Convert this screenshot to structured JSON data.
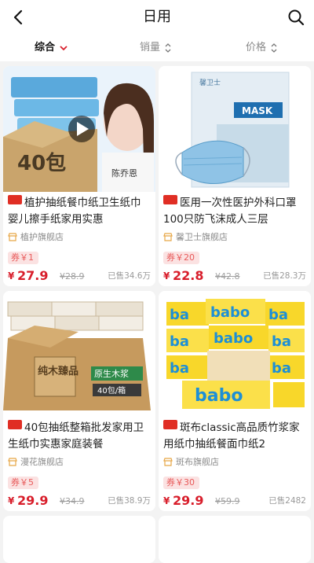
{
  "header": {
    "title": "日用",
    "back_icon": "back-arrow-icon",
    "search_icon": "search-icon"
  },
  "sort": {
    "items": [
      {
        "label": "综合",
        "active": true,
        "icon": "chevron-down-icon"
      },
      {
        "label": "销量",
        "active": false,
        "icon": "sort-updown-icon"
      },
      {
        "label": "价格",
        "active": false,
        "icon": "sort-updown-icon"
      }
    ]
  },
  "products": [
    {
      "title": "植护抽纸餐巾纸卫生纸巾婴儿擦手纸家用实惠",
      "shop": "植护旗舰店",
      "coupon": "券￥1",
      "currency": "¥",
      "price": "27.9",
      "original": "¥28.9",
      "sold": "已售34.6万",
      "thumb_text": "40包"
    },
    {
      "title": "医用一次性医护外科口罩100只防飞沫成人三层",
      "shop": "馨卫士旗舰店",
      "coupon": "券￥20",
      "currency": "¥",
      "price": "22.8",
      "original": "¥42.8",
      "sold": "已售28.3万",
      "thumb_text": "MASK",
      "thumb_brand": "馨卫士"
    },
    {
      "title": "40包抽纸整箱批发家用卫生纸巾实惠家庭装餐",
      "shop": "漫花旗舰店",
      "coupon": "券￥5",
      "currency": "¥",
      "price": "29.9",
      "original": "¥34.9",
      "sold": "已售38.9万",
      "thumb_text": "纯木臻品",
      "thumb_text2": "原生木浆",
      "thumb_text3": "40包/箱"
    },
    {
      "title": "斑布classic高品质竹浆家用纸巾抽纸餐面巾纸2",
      "shop": "斑布旗舰店",
      "coupon": "券￥30",
      "currency": "¥",
      "price": "29.9",
      "original": "¥59.9",
      "sold": "已售2482",
      "thumb_text": "babo"
    }
  ],
  "colors": {
    "accent": "#d81e2b",
    "tmall": "#e02e24",
    "coupon_bg": "#fbe2e2"
  }
}
